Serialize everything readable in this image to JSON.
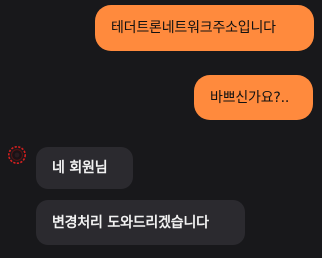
{
  "theme": {
    "accent": "#ff8a3d",
    "incoming_bg": "#2b2a2f",
    "background": "#18181b"
  },
  "chat": {
    "messages": [
      {
        "sender": "me",
        "text": "테더트론네트워크주소입니다"
      },
      {
        "sender": "me",
        "text": "바쁘신가요?.."
      },
      {
        "sender": "agent",
        "text": "네 회원님"
      },
      {
        "sender": "agent",
        "text": "변경처리 도와드리겠습니다"
      }
    ],
    "agent_avatar": "avatar-ring-icon"
  }
}
